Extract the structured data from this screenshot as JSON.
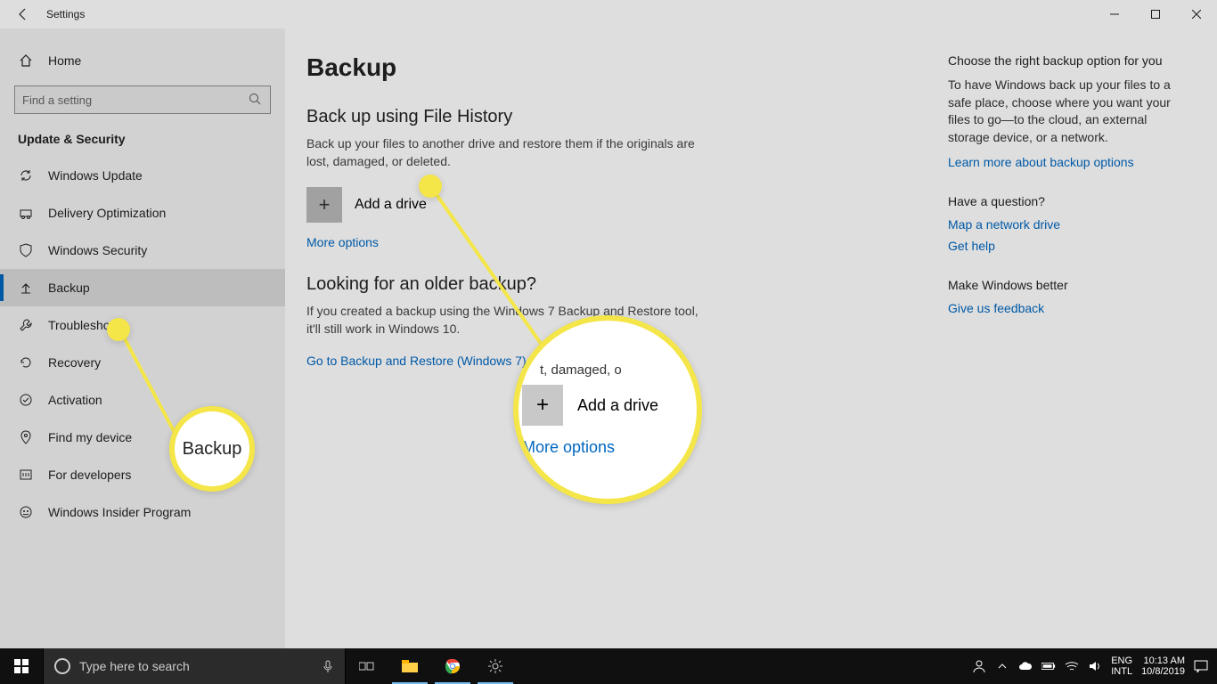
{
  "window": {
    "title": "Settings",
    "page_title": "Backup"
  },
  "sidebar": {
    "home": "Home",
    "search_placeholder": "Find a setting",
    "category": "Update & Security",
    "items": [
      {
        "label": "Windows Update"
      },
      {
        "label": "Delivery Optimization"
      },
      {
        "label": "Windows Security"
      },
      {
        "label": "Backup"
      },
      {
        "label": "Troubleshoot"
      },
      {
        "label": "Recovery"
      },
      {
        "label": "Activation"
      },
      {
        "label": "Find my device"
      },
      {
        "label": "For developers"
      },
      {
        "label": "Windows Insider Program"
      }
    ]
  },
  "main": {
    "section1_title": "Back up using File History",
    "section1_desc": "Back up your files to another drive and restore them if the originals are lost, damaged, or deleted.",
    "add_drive_label": "Add a drive",
    "more_options": "More options",
    "section2_title": "Looking for an older backup?",
    "section2_desc": "If you created a backup using the Windows 7 Backup and Restore tool, it'll still work in Windows 10.",
    "legacy_link": "Go to Backup and Restore (Windows 7)"
  },
  "rail": {
    "help_title": "Choose the right backup option for you",
    "help_desc": "To have Windows back up your files to a safe place, choose where you want your files to go—to the cloud, an external storage device, or a network.",
    "help_link": "Learn more about backup options",
    "q_title": "Have a question?",
    "q_link1": "Map a network drive",
    "q_link2": "Get help",
    "fb_title": "Make Windows better",
    "fb_link": "Give us feedback"
  },
  "callouts": {
    "c1_label": "Backup",
    "c2_hint": "t, damaged, o",
    "c2_add": "Add a drive",
    "c2_more": "More options"
  },
  "taskbar": {
    "search_placeholder": "Type here to search",
    "lang1": "ENG",
    "lang2": "INTL",
    "time": "10:13 AM",
    "date": "10/8/2019"
  }
}
